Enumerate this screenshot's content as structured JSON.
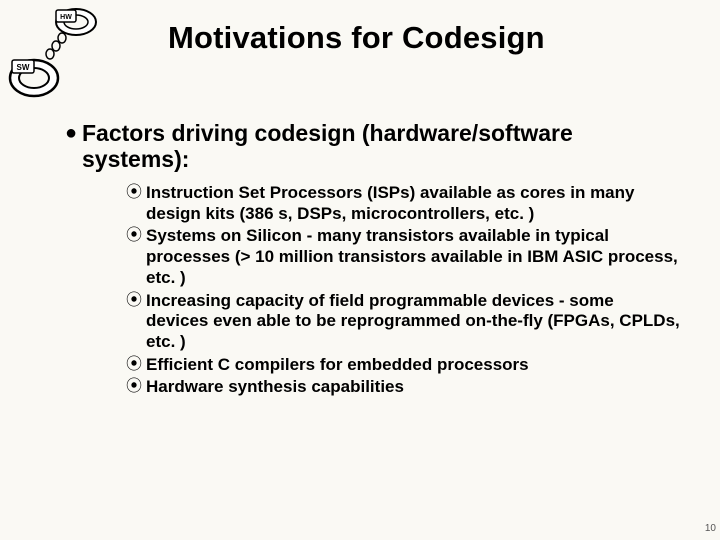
{
  "logo": {
    "hw": "HW",
    "sw": "SW"
  },
  "title": "Motivations for Codesign",
  "main": {
    "text": "Factors driving codesign (hardware/software systems):"
  },
  "subs": [
    "Instruction Set Processors (ISPs) available as cores in many design kits (386 s, DSPs, microcontrollers, etc. )",
    "Systems on Silicon - many transistors available in typical processes (> 10 million transistors available in IBM ASIC process, etc. )",
    "Increasing capacity of field programmable devices - some devices even able to be reprogrammed on-the-fly (FPGAs, CPLDs, etc. )",
    "Efficient C compilers for embedded processors",
    "Hardware synthesis capabilities"
  ],
  "page": "10"
}
